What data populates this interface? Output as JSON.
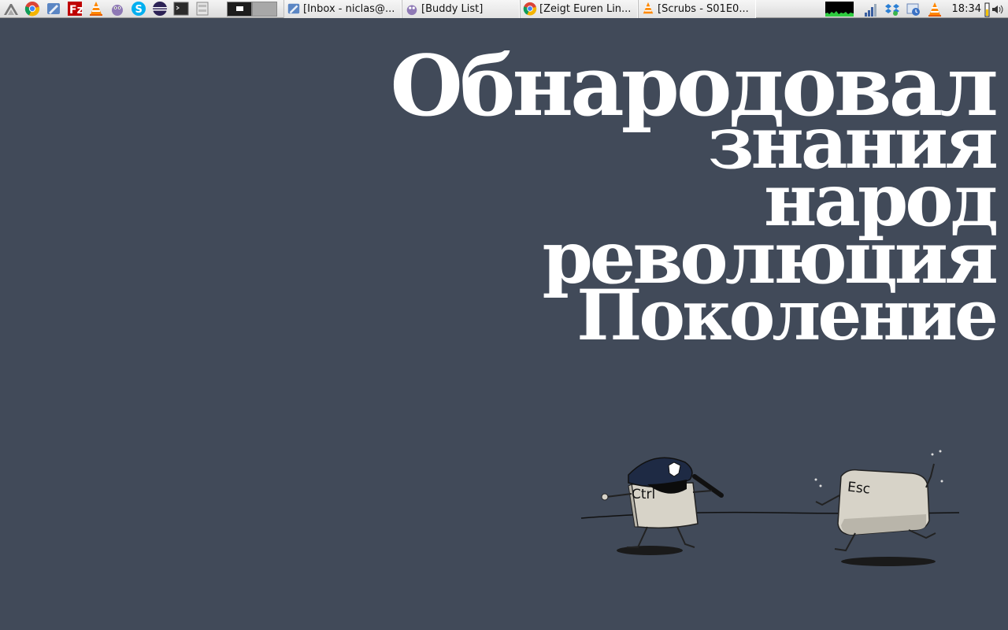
{
  "panel": {
    "launchers": [
      {
        "name": "menu-icon"
      },
      {
        "name": "chrome-icon"
      },
      {
        "name": "mail-icon"
      },
      {
        "name": "filezilla-icon"
      },
      {
        "name": "vlc-icon"
      },
      {
        "name": "pidgin-icon"
      },
      {
        "name": "skype-icon"
      },
      {
        "name": "eclipse-icon"
      },
      {
        "name": "terminal-icon"
      },
      {
        "name": "file-manager-icon"
      }
    ],
    "tasks": [
      {
        "label": "[Inbox - niclas@...",
        "icon": "mail-icon"
      },
      {
        "label": "[Buddy List]",
        "icon": "pidgin-icon"
      },
      {
        "label": "[Zeigt Euren Lin...",
        "icon": "chrome-icon"
      },
      {
        "label": "[Scrubs - S01E0...",
        "icon": "vlc-icon"
      }
    ],
    "tray": {
      "clock": "18:34",
      "icons": [
        "signal-icon",
        "dropbox-icon",
        "update-icon",
        "vlc-tray-icon"
      ]
    }
  },
  "wallpaper": {
    "lines": [
      "Обнародовал",
      "знания",
      "народ",
      "революция",
      "Поколение"
    ],
    "keys": {
      "ctrl": "Ctrl",
      "esc": "Esc"
    }
  }
}
